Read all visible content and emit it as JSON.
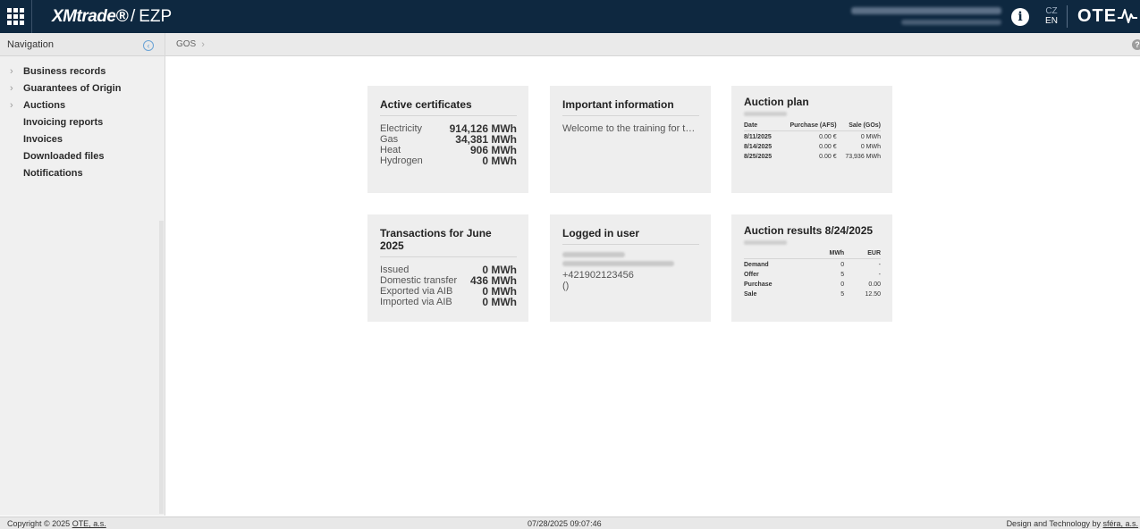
{
  "header": {
    "brand_logo": "XMtrade®",
    "brand_sep": "/",
    "brand_app": "EZP",
    "info_icon": "i",
    "lang_cz": "CZ",
    "lang_en": "EN",
    "ote_logo": "OTE"
  },
  "sidebar": {
    "title": "Navigation",
    "collapse_icon": "‹",
    "items": [
      {
        "label": "Business records",
        "chevron": "›"
      },
      {
        "label": "Guarantees of Origin",
        "chevron": "›"
      },
      {
        "label": "Auctions",
        "chevron": "›"
      },
      {
        "label": "Invoicing reports",
        "chevron": ""
      },
      {
        "label": "Invoices",
        "chevron": ""
      },
      {
        "label": "Downloaded files",
        "chevron": ""
      },
      {
        "label": "Notifications",
        "chevron": ""
      }
    ]
  },
  "breadcrumb": {
    "items": [
      "GOS"
    ],
    "chevron": "›",
    "help_icon": "?"
  },
  "cards": {
    "active_certificates": {
      "title": "Active certificates",
      "rows": [
        {
          "name": "Electricity",
          "value": "914,126 MWh"
        },
        {
          "name": "Gas",
          "value": "34,381 MWh"
        },
        {
          "name": "Heat",
          "value": "906 MWh"
        },
        {
          "name": "Hydrogen",
          "value": "0 MWh"
        }
      ]
    },
    "important_info": {
      "title": "Important information",
      "text": "Welcome to the training for the new ..."
    },
    "auction_plan": {
      "title": "Auction plan",
      "headers": [
        "Date",
        "Purchase (AFS)",
        "Sale (GOs)"
      ],
      "rows": [
        [
          "8/11/2025",
          "0.00 €",
          "0 MWh"
        ],
        [
          "8/14/2025",
          "0.00 €",
          "0 MWh"
        ],
        [
          "8/25/2025",
          "0.00 €",
          "73,936 MWh"
        ]
      ]
    },
    "transactions": {
      "title": "Transactions for June 2025",
      "rows": [
        {
          "name": "Issued",
          "value": "0 MWh"
        },
        {
          "name": "Domestic transfer",
          "value": "436 MWh"
        },
        {
          "name": "Exported via AIB",
          "value": "0 MWh"
        },
        {
          "name": "Imported via AIB",
          "value": "0 MWh"
        }
      ]
    },
    "logged_user": {
      "title": "Logged in user",
      "phone": "+421902123456",
      "extra": "()"
    },
    "auction_results": {
      "title": "Auction results 8/24/2025",
      "headers": [
        "",
        "MWh",
        "EUR"
      ],
      "rows": [
        [
          "Demand",
          "0",
          "-"
        ],
        [
          "Offer",
          "5",
          "-"
        ],
        [
          "Purchase",
          "0",
          "0.00"
        ],
        [
          "Sale",
          "5",
          "12.50"
        ]
      ]
    }
  },
  "footer": {
    "copyright_prefix": "Copyright © 2025 ",
    "copyright_link": "OTE, a.s.",
    "timestamp": "07/28/2025 09:07:46",
    "design_prefix": "Design and Technology by ",
    "design_link": "sféra, a.s."
  },
  "colors": {
    "header_bg": "#0e2840",
    "card_bg": "#eeeeee",
    "sidebar_bg": "#f0f0f0"
  }
}
